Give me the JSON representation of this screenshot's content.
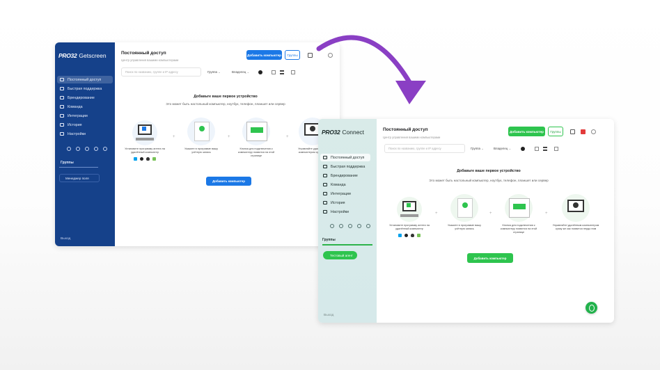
{
  "colors": {
    "getscreen_sidebar": "#15418a",
    "getscreen_accent": "#1b78e6",
    "connect_sidebar": "#d9ebe9",
    "connect_accent": "#2ec44e",
    "arrow": "#8a3fc4",
    "chat_bubble": "#22b24c"
  },
  "window1": {
    "logo_brand": "PRO32",
    "logo_product": "Getscreen",
    "nav": [
      {
        "label": "Постоянный доступ",
        "icon": "monitor-icon"
      },
      {
        "label": "Быстрая поддержка",
        "icon": "lifebuoy-icon"
      },
      {
        "label": "Брендирование",
        "icon": "brush-icon"
      },
      {
        "label": "Команда",
        "icon": "team-icon"
      },
      {
        "label": "Интеграции",
        "icon": "puzzle-icon"
      },
      {
        "label": "История",
        "icon": "history-icon"
      },
      {
        "label": "Настройки",
        "icon": "gear-icon"
      }
    ],
    "group_label": "Группы",
    "sidebar_button": "Менеджер поля",
    "logout": "Выход",
    "header": {
      "title": "Постоянный доступ",
      "subtitle": "Центр управления вашими компьютерами",
      "add_button": "Добавить компьютер",
      "groups_button": "Группы"
    },
    "toolbar": {
      "search_placeholder": "Поиск по названию, группе и IP адресу",
      "filter_group": "Группа",
      "filter_all": "Владелец"
    },
    "empty_state": {
      "title": "Добавьте ваше первое устройство",
      "subtitle": "Это может быть настольный компьютер, ноутбук, телефон, планшет или сервер",
      "steps": [
        "Установите программу агента на удалённый компьютер",
        "Укажите в программе вашу учётную запись",
        "Кнопка для подключения к компьютеру появится на этой странице",
        "Управляйте удалённым компьютером сразу же"
      ],
      "cta": "Добавить компьютер"
    }
  },
  "window2": {
    "logo_brand": "PRO32",
    "logo_product": "Connect",
    "nav": [
      {
        "label": "Постоянный доступ",
        "icon": "monitor-icon"
      },
      {
        "label": "Быстрая поддержка",
        "icon": "lifebuoy-icon"
      },
      {
        "label": "Брендирование",
        "icon": "brush-icon"
      },
      {
        "label": "Команда",
        "icon": "team-icon"
      },
      {
        "label": "Интеграции",
        "icon": "puzzle-icon"
      },
      {
        "label": "История",
        "icon": "history-icon"
      },
      {
        "label": "Настройки",
        "icon": "gear-icon"
      }
    ],
    "group_label": "Группы",
    "sidebar_button": "Тестовый агент",
    "logout": "Выход",
    "header": {
      "title": "Постоянный доступ",
      "subtitle": "Центр управления вашими компьютерами",
      "add_button": "Добавить компьютер",
      "groups_button": "Группы"
    },
    "toolbar": {
      "search_placeholder": "Поиск по названию, группе и IP адресу",
      "filter_group": "Группа",
      "filter_all": "Владелец"
    },
    "empty_state": {
      "title": "Добавьте ваше первое устройство",
      "subtitle": "Это может быть настольный компьютер, ноутбук, телефон, планшет или сервер",
      "steps": [
        "Установите программу агента на удалённый компьютер",
        "Укажите в программе вашу учётную запись",
        "Кнопка для подключения к компьютеру появится на этой странице",
        "Управляйте удалённым компьютером сразу же как появится пердо ним"
      ],
      "cta": "Добавить компьютер"
    }
  }
}
